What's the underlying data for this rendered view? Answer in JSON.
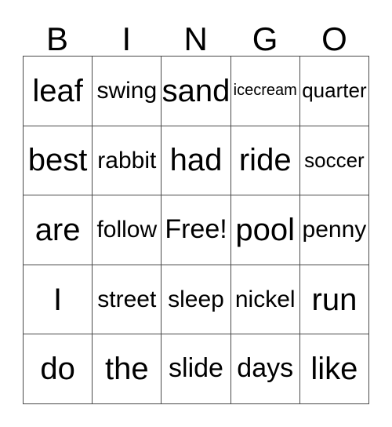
{
  "card": {
    "header_letters": [
      "B",
      "I",
      "N",
      "G",
      "O"
    ],
    "free_space_label": "Free!",
    "grid": [
      [
        {
          "text": "leaf",
          "size": "fs-xl"
        },
        {
          "text": "swing",
          "size": "fs-md"
        },
        {
          "text": "sand",
          "size": "fs-xl"
        },
        {
          "text": "icecream",
          "size": "fs-xs"
        },
        {
          "text": "quarter",
          "size": "fs-sm"
        }
      ],
      [
        {
          "text": "best",
          "size": "fs-xl"
        },
        {
          "text": "rabbit",
          "size": "fs-md"
        },
        {
          "text": "had",
          "size": "fs-xl"
        },
        {
          "text": "ride",
          "size": "fs-xl"
        },
        {
          "text": "soccer",
          "size": "fs-sm"
        }
      ],
      [
        {
          "text": "are",
          "size": "fs-xl"
        },
        {
          "text": "follow",
          "size": "fs-md"
        },
        {
          "text": "Free!",
          "size": "fs-lg"
        },
        {
          "text": "pool",
          "size": "fs-xl"
        },
        {
          "text": "penny",
          "size": "fs-md"
        }
      ],
      [
        {
          "text": "I",
          "size": "fs-xl"
        },
        {
          "text": "street",
          "size": "fs-md"
        },
        {
          "text": "sleep",
          "size": "fs-md"
        },
        {
          "text": "nickel",
          "size": "fs-md"
        },
        {
          "text": "run",
          "size": "fs-xl"
        }
      ],
      [
        {
          "text": "do",
          "size": "fs-xl"
        },
        {
          "text": "the",
          "size": "fs-xl"
        },
        {
          "text": "slide",
          "size": "fs-lg"
        },
        {
          "text": "days",
          "size": "fs-lg"
        },
        {
          "text": "like",
          "size": "fs-xl"
        }
      ]
    ],
    "colors": {
      "background": "#ffffff",
      "text": "#000000",
      "border": "#4a4a4a"
    }
  }
}
